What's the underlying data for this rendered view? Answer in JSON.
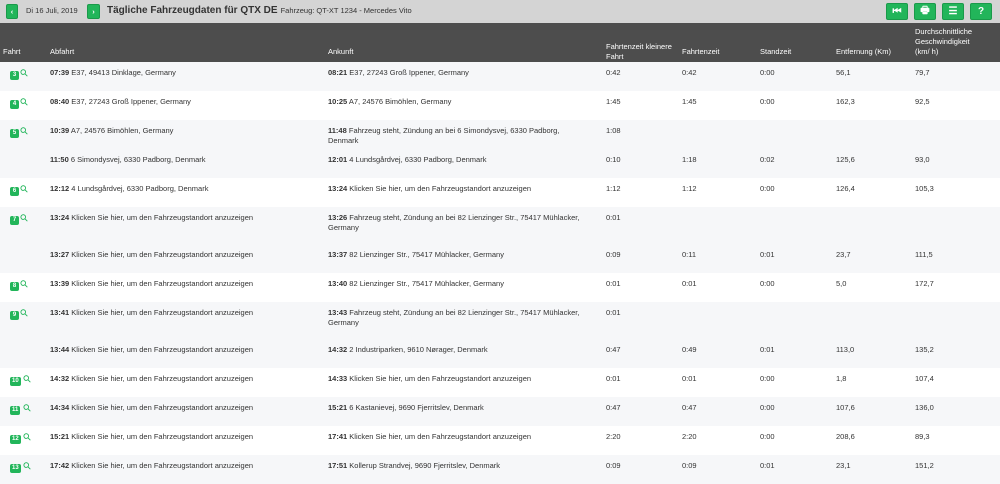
{
  "toolbar": {
    "date": "Di 16 Juli, 2019",
    "title": "Tägliche Fahrzeugdaten für QTX DE",
    "vehicle": "Fahrzeug: QT-XT 1234 - Mercedes Vito",
    "prev_icon": "chevron-left-icon",
    "next_icon": "chevron-right-icon",
    "buttons": [
      {
        "name": "skip-back",
        "glyph": "⏮"
      },
      {
        "name": "print",
        "glyph": "🖶"
      },
      {
        "name": "menu",
        "glyph": "☰"
      },
      {
        "name": "help",
        "glyph": "?"
      }
    ]
  },
  "accent": "#22b55a",
  "columns": [
    "Fahrt",
    "Abfahrt",
    "Ankunft",
    "Fahrtenzeit kleinere Fahrt",
    "Fahrtenzeit",
    "Standzeit",
    "Entfernung (Km)",
    "Durchschnittliche Geschwindigkeit (km/ h)"
  ],
  "trips": [
    {
      "n": "3",
      "fahrtenzeit": "0:42",
      "standzeit": "0:00",
      "entfernung": "56,1",
      "speed": "79,7",
      "legs": [
        {
          "dt": "07:39",
          "dep": "E37, 49413 Dinklage, Germany",
          "at": "08:21",
          "arr": "E37, 27243 Groß Ippener, Germany",
          "small": "0:42"
        }
      ]
    },
    {
      "n": "4",
      "fahrtenzeit": "1:45",
      "standzeit": "0:00",
      "entfernung": "162,3",
      "speed": "92,5",
      "legs": [
        {
          "dt": "08:40",
          "dep": "E37, 27243 Groß Ippener, Germany",
          "at": "10:25",
          "arr": "A7, 24576 Bimöhlen, Germany",
          "small": "1:45"
        }
      ]
    },
    {
      "n": "5",
      "fahrtenzeit": "1:18",
      "standzeit": "0:02",
      "entfernung": "125,6",
      "speed": "93,0",
      "legs": [
        {
          "dt": "10:39",
          "dep": "A7, 24576 Bimöhlen, Germany",
          "at": "11:48",
          "arr": "Fahrzeug steht, Zündung an bei 6 Simondysvej, 6330 Padborg, Denmark",
          "small": "1:08"
        },
        {
          "dt": "11:50",
          "dep": "6 Simondysvej, 6330 Padborg, Denmark",
          "at": "12:01",
          "arr": "4 Lundsgårdvej, 6330 Padborg, Denmark",
          "small": "0:10"
        }
      ]
    },
    {
      "n": "6",
      "fahrtenzeit": "1:12",
      "standzeit": "0:00",
      "entfernung": "126,4",
      "speed": "105,3",
      "legs": [
        {
          "dt": "12:12",
          "dep": "4 Lundsgårdvej, 6330 Padborg, Denmark",
          "at": "13:24",
          "arr": "Klicken Sie hier, um den Fahrzeugstandort anzuzeigen",
          "small": "1:12"
        }
      ]
    },
    {
      "n": "7",
      "fahrtenzeit": "0:11",
      "standzeit": "0:01",
      "entfernung": "23,7",
      "speed": "111,5",
      "legs": [
        {
          "dt": "13:24",
          "dep": "Klicken Sie hier, um den Fahrzeugstandort anzuzeigen",
          "at": "13:26",
          "arr": "Fahrzeug steht, Zündung an bei 82 Lienzinger Str., 75417 Mühlacker, Germany",
          "small": "0:01",
          "tall": true
        },
        {
          "dt": "13:27",
          "dep": "Klicken Sie hier, um den Fahrzeugstandort anzuzeigen",
          "at": "13:37",
          "arr": "82 Lienzinger Str., 75417 Mühlacker, Germany",
          "small": "0:09"
        }
      ]
    },
    {
      "n": "8",
      "fahrtenzeit": "0:01",
      "standzeit": "0:00",
      "entfernung": "5,0",
      "speed": "172,7",
      "legs": [
        {
          "dt": "13:39",
          "dep": "Klicken Sie hier, um den Fahrzeugstandort anzuzeigen",
          "at": "13:40",
          "arr": "82 Lienzinger Str., 75417 Mühlacker, Germany",
          "small": "0:01"
        }
      ]
    },
    {
      "n": "9",
      "fahrtenzeit": "0:49",
      "standzeit": "0:01",
      "entfernung": "113,0",
      "speed": "135,2",
      "legs": [
        {
          "dt": "13:41",
          "dep": "Klicken Sie hier, um den Fahrzeugstandort anzuzeigen",
          "at": "13:43",
          "arr": "Fahrzeug steht, Zündung an bei 82 Lienzinger Str., 75417 Mühlacker, Germany",
          "small": "0:01",
          "tall": true
        },
        {
          "dt": "13:44",
          "dep": "Klicken Sie hier, um den Fahrzeugstandort anzuzeigen",
          "at": "14:32",
          "arr": "2 Industriparken, 9610 Nørager, Denmark",
          "small": "0:47"
        }
      ]
    },
    {
      "n": "10",
      "fahrtenzeit": "0:01",
      "standzeit": "0:00",
      "entfernung": "1,8",
      "speed": "107,4",
      "legs": [
        {
          "dt": "14:32",
          "dep": "Klicken Sie hier, um den Fahrzeugstandort anzuzeigen",
          "at": "14:33",
          "arr": "Klicken Sie hier, um den Fahrzeugstandort anzuzeigen",
          "small": "0:01"
        }
      ]
    },
    {
      "n": "11",
      "fahrtenzeit": "0:47",
      "standzeit": "0:00",
      "entfernung": "107,6",
      "speed": "136,0",
      "legs": [
        {
          "dt": "14:34",
          "dep": "Klicken Sie hier, um den Fahrzeugstandort anzuzeigen",
          "at": "15:21",
          "arr": "6 Kastanievej, 9690 Fjerritslev, Denmark",
          "small": "0:47"
        }
      ]
    },
    {
      "n": "12",
      "fahrtenzeit": "2:20",
      "standzeit": "0:00",
      "entfernung": "208,6",
      "speed": "89,3",
      "legs": [
        {
          "dt": "15:21",
          "dep": "Klicken Sie hier, um den Fahrzeugstandort anzuzeigen",
          "at": "17:41",
          "arr": "Klicken Sie hier, um den Fahrzeugstandort anzuzeigen",
          "small": "2:20"
        }
      ]
    },
    {
      "n": "13",
      "fahrtenzeit": "0:09",
      "standzeit": "0:01",
      "entfernung": "23,1",
      "speed": "151,2",
      "legs": [
        {
          "dt": "17:42",
          "dep": "Klicken Sie hier, um den Fahrzeugstandort anzuzeigen",
          "at": "17:51",
          "arr": "Kollerup Strandvej, 9690 Fjerritslev, Denmark",
          "small": "0:09"
        }
      ]
    }
  ]
}
